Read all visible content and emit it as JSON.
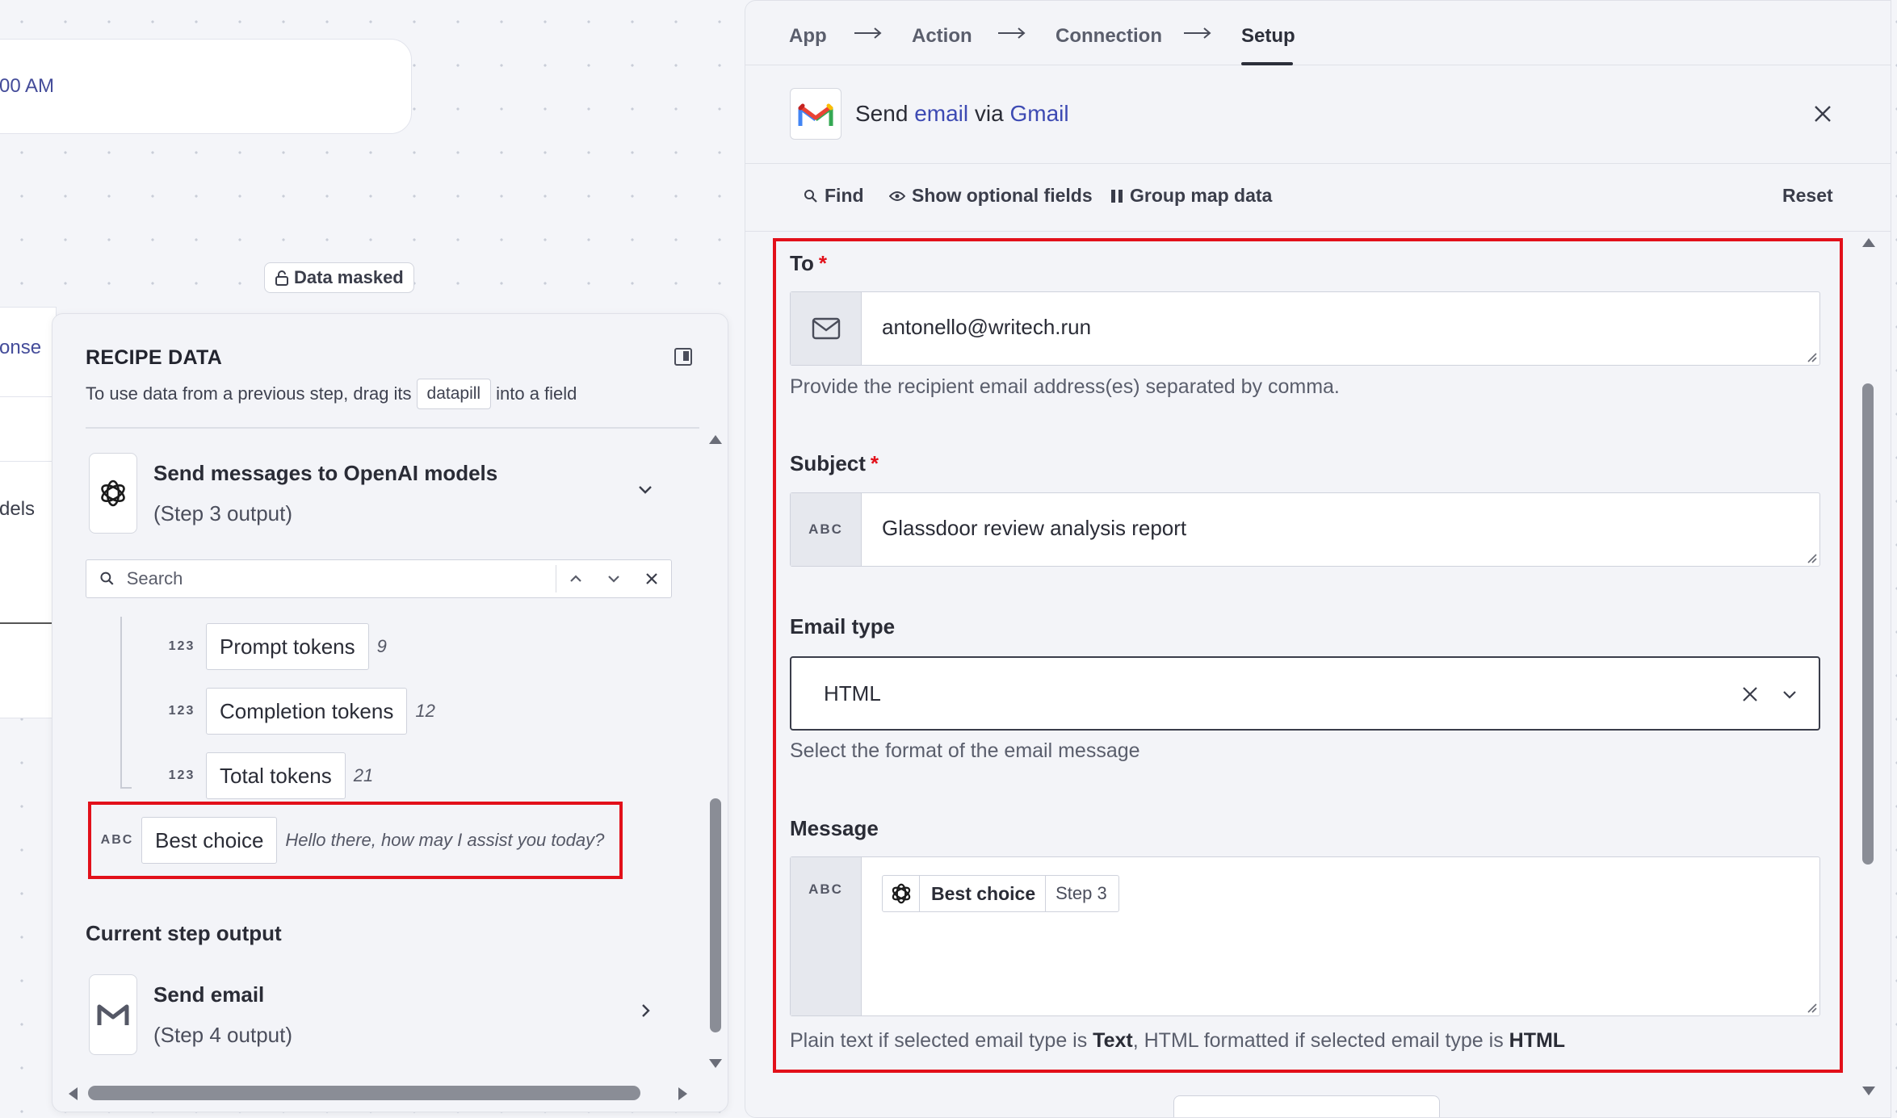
{
  "canvas": {
    "time_fragment": "00 AM",
    "response_fragment": "onse",
    "models_fragment": "dels",
    "data_masked": "Data masked"
  },
  "recipe": {
    "title": "RECIPE DATA",
    "instruction_before": "To use data from a previous step, drag its",
    "datapill": "datapill",
    "instruction_after": "into a field",
    "step3": {
      "name": "Send messages to OpenAI models",
      "output": "(Step 3 output)"
    },
    "search": {
      "placeholder": "Search"
    },
    "pills": [
      {
        "type": "123",
        "label": "Prompt tokens",
        "value": "9"
      },
      {
        "type": "123",
        "label": "Completion tokens",
        "value": "12"
      },
      {
        "type": "123",
        "label": "Total tokens",
        "value": "21"
      },
      {
        "type": "ABC",
        "label": "Best choice",
        "value": "Hello there, how may I assist you today?"
      }
    ],
    "current_step_title": "Current step output",
    "step4": {
      "name": "Send email",
      "output": "(Step 4 output)"
    }
  },
  "setup": {
    "wizard": [
      "App",
      "Action",
      "Connection",
      "Setup"
    ],
    "header": {
      "prefix": "Send",
      "action": "email",
      "via": "via",
      "app": "Gmail"
    },
    "toolbar": {
      "find": "Find",
      "optional": "Show optional fields",
      "group": "Group map data",
      "reset": "Reset"
    },
    "fields": {
      "to": {
        "label": "To",
        "required": "*",
        "value": "antonello@writech.run",
        "help": "Provide the recipient email address(es) separated by comma."
      },
      "subject": {
        "label": "Subject",
        "required": "*",
        "type": "ABC",
        "value": "Glassdoor review analysis report"
      },
      "email_type": {
        "label": "Email type",
        "value": "HTML",
        "help": "Select the format of the email message"
      },
      "message": {
        "label": "Message",
        "type": "ABC",
        "pill_name": "Best choice",
        "pill_step": "Step 3",
        "help_1": "Plain text if selected email type is ",
        "help_b1": "Text",
        "help_2": ", HTML formatted if selected email type is ",
        "help_b2": "HTML"
      }
    }
  },
  "colors": {
    "accent_link": "#3d4ab3",
    "highlight": "#e2101a",
    "required": "#e2101a"
  }
}
